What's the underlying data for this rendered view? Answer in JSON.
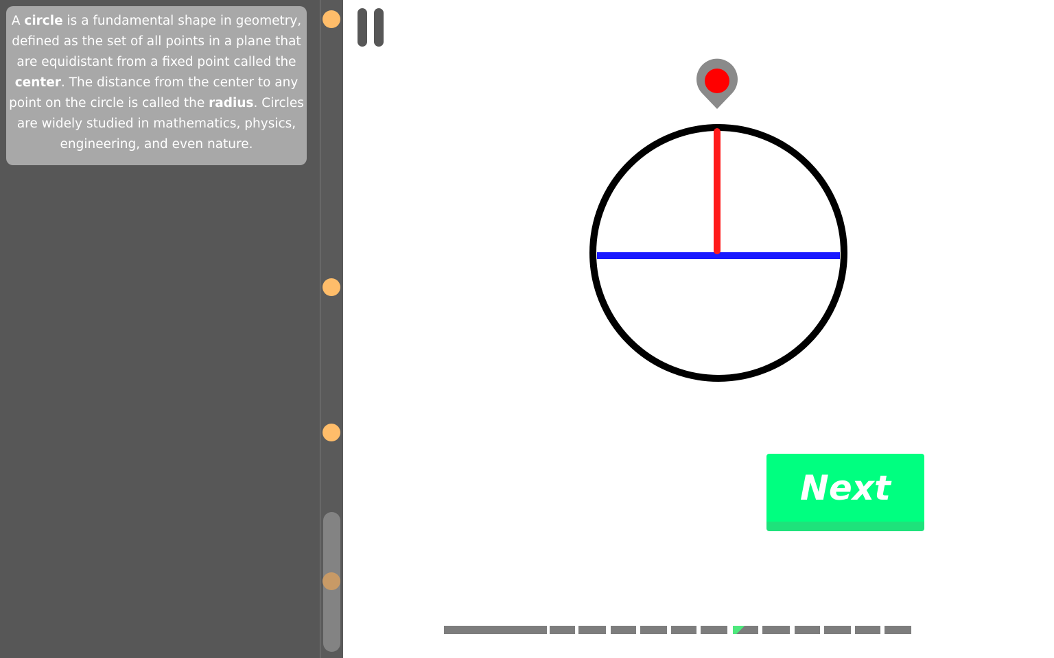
{
  "lesson": {
    "paragraph": [
      {
        "text": "A ",
        "bold": false
      },
      {
        "text": "circle",
        "bold": true
      },
      {
        "text": " is a fundamental shape in geometry, defined as the set of all points in a plane that are equidistant from a fixed point called the ",
        "bold": false
      },
      {
        "text": "center",
        "bold": true
      },
      {
        "text": ". The distance from the center to any point on the circle is called the ",
        "bold": false
      },
      {
        "text": "radius",
        "bold": true
      },
      {
        "text": ". Circles are widely studied in mathematics, physics, engineering, and even nature.",
        "bold": false
      }
    ]
  },
  "controls": {
    "pause_icon": "pause-icon",
    "next_label": "Next"
  },
  "figure": {
    "shape": "circle",
    "radius_color": "#ff1a1a",
    "diameter_color": "#1a1aff",
    "outline_color": "#000000",
    "marker_icon": "map-pin-icon",
    "marker_color": "#ff0000"
  },
  "progress": {
    "segment_count": 13,
    "current_segment": 7,
    "current_fill_fraction": 0.35,
    "accent": "#4ee87d"
  },
  "colors": {
    "panel": "#575757",
    "card": "#a8a8a8",
    "dot": "#ffbd6a",
    "next": "#00ff80"
  }
}
